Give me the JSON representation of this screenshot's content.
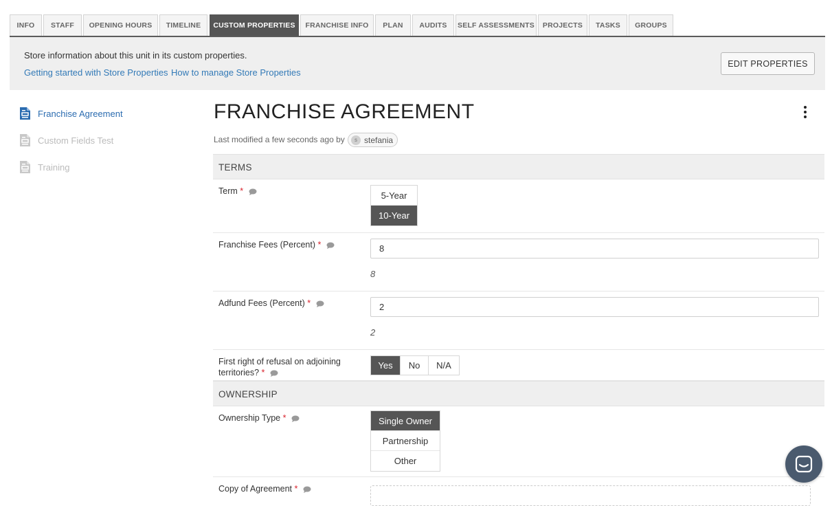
{
  "tabs": [
    {
      "label": "INFO",
      "active": false
    },
    {
      "label": "STAFF",
      "active": false
    },
    {
      "label": "OPENING HOURS",
      "active": false
    },
    {
      "label": "TIMELINE",
      "active": false
    },
    {
      "label": "CUSTOM PROPERTIES",
      "active": true
    },
    {
      "label": "FRANCHISE INFO",
      "active": false
    },
    {
      "label": "PLAN",
      "active": false
    },
    {
      "label": "AUDITS",
      "active": false
    },
    {
      "label": "SELF ASSESSMENTS",
      "active": false
    },
    {
      "label": "PROJECTS",
      "active": false
    },
    {
      "label": "TASKS",
      "active": false
    },
    {
      "label": "GROUPS",
      "active": false
    }
  ],
  "info": {
    "text": "Store information about this unit in its custom properties.",
    "link1": "Getting started with Store Properties",
    "link2": "How to manage Store Properties",
    "edit_button": "EDIT PROPERTIES"
  },
  "sidebar": {
    "items": [
      {
        "label": "Franchise Agreement",
        "active": true,
        "icon": "document-icon"
      },
      {
        "label": "Custom Fields Test",
        "active": false,
        "icon": "document-icon"
      },
      {
        "label": "Training",
        "active": false,
        "icon": "document-icon"
      }
    ]
  },
  "main": {
    "title": "FRANCHISE AGREEMENT",
    "modified_text": "Last modified a few seconds ago by",
    "user_initial": "s",
    "user_name": "stefania",
    "sections": {
      "terms": "TERMS",
      "ownership": "OWNERSHIP"
    },
    "fields": {
      "term": {
        "label": "Term",
        "options": [
          "5-Year",
          "10-Year"
        ],
        "selected": "10-Year"
      },
      "franchise_fees": {
        "label": "Franchise Fees (Percent)",
        "value": "8",
        "preview": "8"
      },
      "adfund_fees": {
        "label": "Adfund Fees (Percent)",
        "value": "2",
        "preview": "2"
      },
      "first_right": {
        "label": "First right of refusal on adjoining territories?",
        "options": [
          "Yes",
          "No",
          "N/A"
        ],
        "selected": "Yes"
      },
      "ownership_type": {
        "label": "Ownership Type",
        "options": [
          "Single Owner",
          "Partnership",
          "Other"
        ],
        "selected": "Single Owner"
      },
      "copy_of_agreement": {
        "label": "Copy of Agreement"
      }
    },
    "required_mark": "*"
  },
  "colors": {
    "accent": "#2b6cb0",
    "active_tab": "#555555",
    "selected_option": "#555555",
    "required": "#d9232d",
    "chat": "#4a5a6e"
  }
}
